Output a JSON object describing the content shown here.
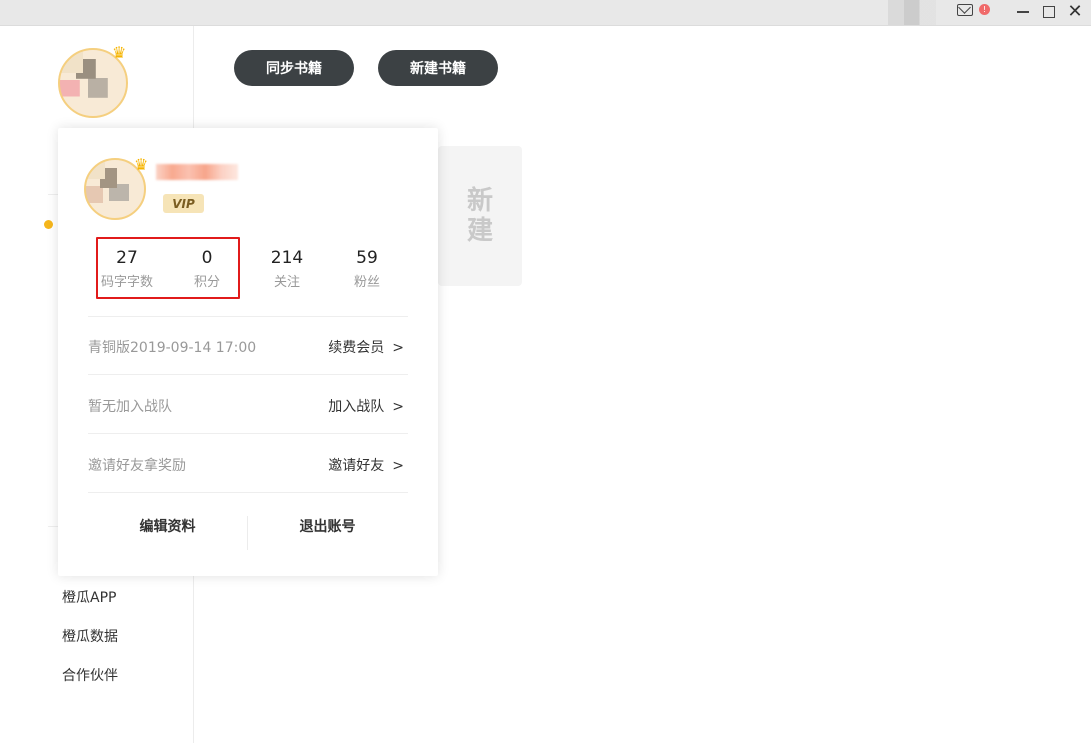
{
  "window": {
    "controls": {
      "close": "✕"
    }
  },
  "toolbar": {
    "sync_books": "同步书籍",
    "new_book": "新建书籍"
  },
  "new_card": {
    "line1": "新",
    "line2": "建"
  },
  "sidebar": {
    "links": [
      "橙瓜APP",
      "橙瓜数据",
      "合作伙伴"
    ]
  },
  "profile_popup": {
    "badge": "VIP",
    "stats": [
      {
        "value": "27",
        "label": "码字字数"
      },
      {
        "value": "0",
        "label": "积分"
      },
      {
        "value": "214",
        "label": "关注"
      },
      {
        "value": "59",
        "label": "粉丝"
      }
    ],
    "rows": [
      {
        "info": "青铜版2019-09-14 17:00",
        "action": "续费会员",
        "arrow": ">"
      },
      {
        "info": "暂无加入战队",
        "action": "加入战队",
        "arrow": ">"
      },
      {
        "info": "邀请好友拿奖励",
        "action": "邀请好友",
        "arrow": ">"
      }
    ],
    "edit_profile": "编辑资料",
    "logout": "退出账号"
  },
  "icons": [
    "mail-icon",
    "alert-icon",
    "minimize-icon",
    "maximize-icon",
    "close-icon",
    "crown-icon",
    "avatar"
  ],
  "colors": {
    "highlight_border": "#e11b1b",
    "primary_button": "#3c4144",
    "accent_dot": "#f5b61c",
    "vip_badge": "#f6e4b7"
  }
}
